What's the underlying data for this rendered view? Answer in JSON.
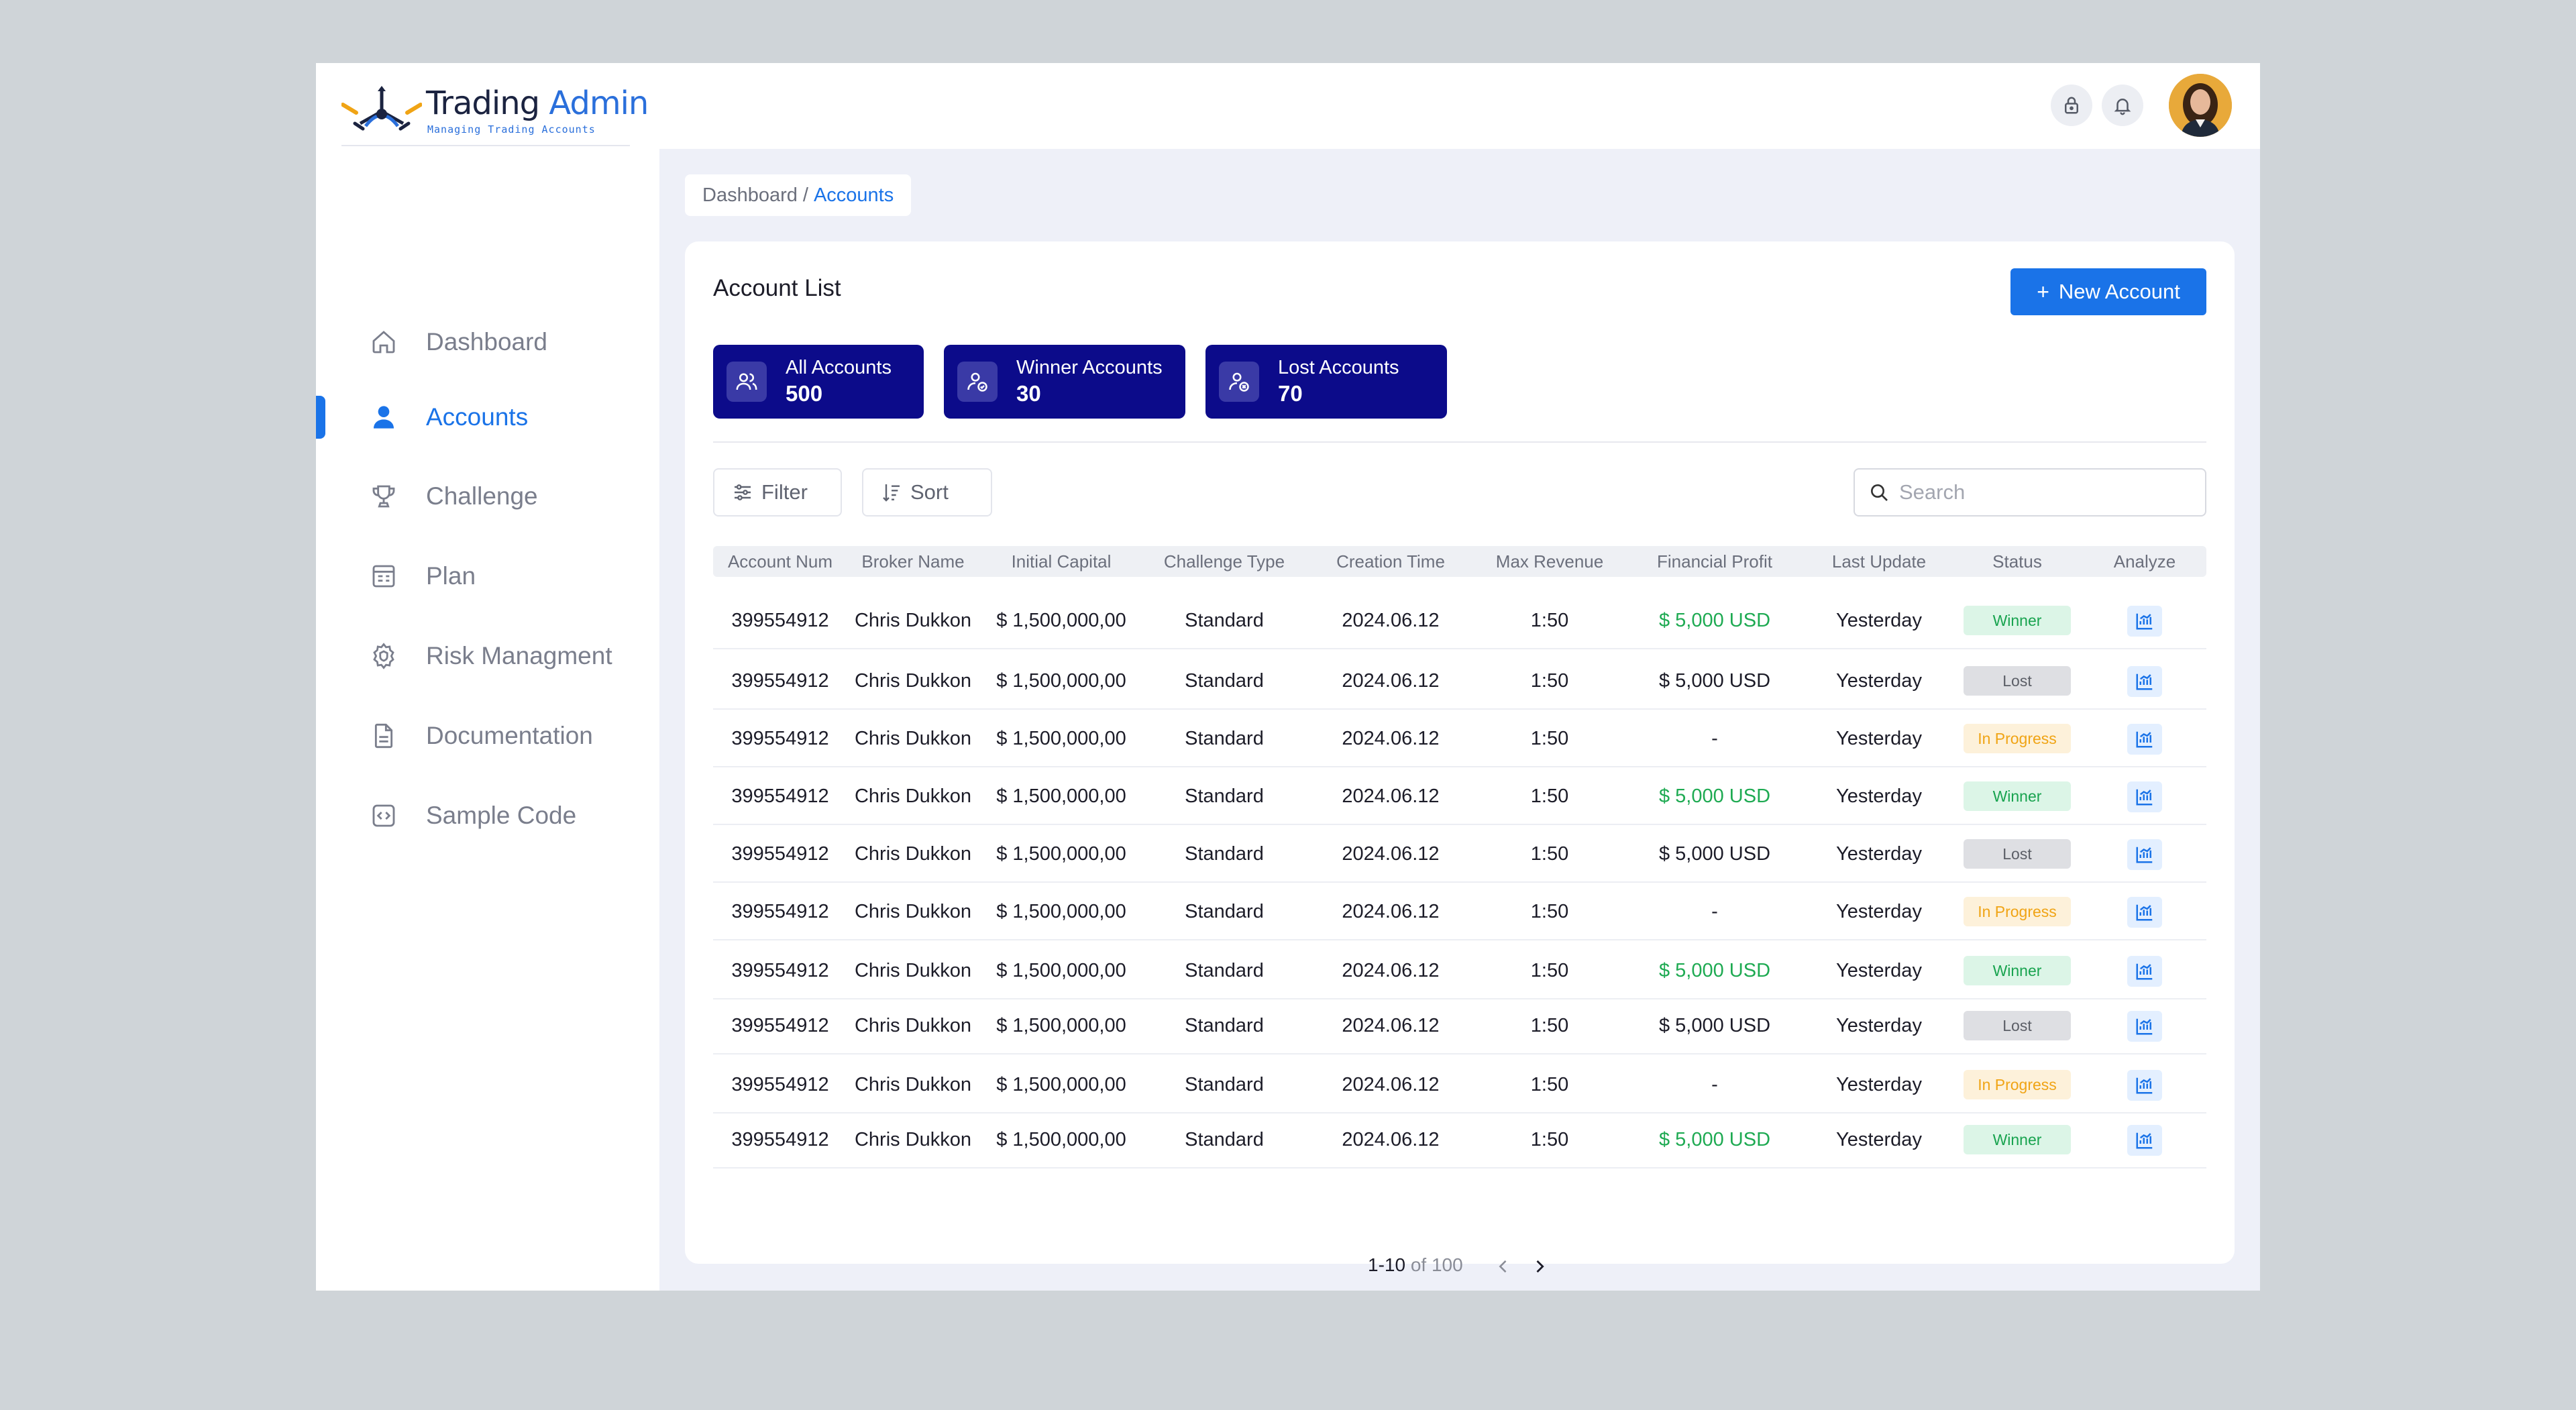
{
  "app": {
    "title_part1": "Trading",
    "title_part2": "Admin",
    "subtitle": "Managing Trading Accounts"
  },
  "sidebar": {
    "items": [
      {
        "label": "Dashboard",
        "icon": "home-icon"
      },
      {
        "label": "Accounts",
        "icon": "user-icon",
        "active": true
      },
      {
        "label": "Challenge",
        "icon": "trophy-icon"
      },
      {
        "label": "Plan",
        "icon": "plan-icon"
      },
      {
        "label": "Risk Managment",
        "icon": "gear-shield-icon"
      },
      {
        "label": "Documentation",
        "icon": "document-icon"
      },
      {
        "label": "Sample Code",
        "icon": "code-icon"
      }
    ]
  },
  "breadcrumb": {
    "root": "Dashboard",
    "separator": "/",
    "current": "Accounts"
  },
  "card": {
    "title": "Account List",
    "new_button": "New Account",
    "new_button_icon": "+"
  },
  "stats": [
    {
      "label": "All Accounts",
      "value": "500"
    },
    {
      "label": "Winner Accounts",
      "value": "30"
    },
    {
      "label": "Lost Accounts",
      "value": "70"
    }
  ],
  "toolbar": {
    "filter": "Filter",
    "sort": "Sort",
    "search_placeholder": "Search"
  },
  "table": {
    "columns": [
      "Account Num",
      "Broker Name",
      "Initial Capital",
      "Challenge Type",
      "Creation Time",
      "Max Revenue",
      "Financial Profit",
      "Last Update",
      "Status",
      "Analyze"
    ],
    "rows": [
      {
        "account": "399554912",
        "broker": "Chris Dukkon",
        "capital": "$ 1,500,000,00",
        "type": "Standard",
        "created": "2024.06.12",
        "max_revenue": "1:50",
        "profit": "$ 5,000 USD",
        "last_update": "Yesterday",
        "status": "Winner"
      },
      {
        "account": "399554912",
        "broker": "Chris Dukkon",
        "capital": "$ 1,500,000,00",
        "type": "Standard",
        "created": "2024.06.12",
        "max_revenue": "1:50",
        "profit": "$ 5,000 USD",
        "last_update": "Yesterday",
        "status": "Lost"
      },
      {
        "account": "399554912",
        "broker": "Chris Dukkon",
        "capital": "$ 1,500,000,00",
        "type": "Standard",
        "created": "2024.06.12",
        "max_revenue": "1:50",
        "profit": "-",
        "last_update": "Yesterday",
        "status": "In Progress"
      },
      {
        "account": "399554912",
        "broker": "Chris Dukkon",
        "capital": "$ 1,500,000,00",
        "type": "Standard",
        "created": "2024.06.12",
        "max_revenue": "1:50",
        "profit": "$ 5,000 USD",
        "last_update": "Yesterday",
        "status": "Winner"
      },
      {
        "account": "399554912",
        "broker": "Chris Dukkon",
        "capital": "$ 1,500,000,00",
        "type": "Standard",
        "created": "2024.06.12",
        "max_revenue": "1:50",
        "profit": "$ 5,000 USD",
        "last_update": "Yesterday",
        "status": "Lost"
      },
      {
        "account": "399554912",
        "broker": "Chris Dukkon",
        "capital": "$ 1,500,000,00",
        "type": "Standard",
        "created": "2024.06.12",
        "max_revenue": "1:50",
        "profit": "-",
        "last_update": "Yesterday",
        "status": "In Progress"
      },
      {
        "account": "399554912",
        "broker": "Chris Dukkon",
        "capital": "$ 1,500,000,00",
        "type": "Standard",
        "created": "2024.06.12",
        "max_revenue": "1:50",
        "profit": "$ 5,000 USD",
        "last_update": "Yesterday",
        "status": "Winner"
      },
      {
        "account": "399554912",
        "broker": "Chris Dukkon",
        "capital": "$ 1,500,000,00",
        "type": "Standard",
        "created": "2024.06.12",
        "max_revenue": "1:50",
        "profit": "$ 5,000 USD",
        "last_update": "Yesterday",
        "status": "Lost"
      },
      {
        "account": "399554912",
        "broker": "Chris Dukkon",
        "capital": "$ 1,500,000,00",
        "type": "Standard",
        "created": "2024.06.12",
        "max_revenue": "1:50",
        "profit": "-",
        "last_update": "Yesterday",
        "status": "In Progress"
      },
      {
        "account": "399554912",
        "broker": "Chris Dukkon",
        "capital": "$ 1,500,000,00",
        "type": "Standard",
        "created": "2024.06.12",
        "max_revenue": "1:50",
        "profit": "$ 5,000 USD",
        "last_update": "Yesterday",
        "status": "Winner"
      }
    ]
  },
  "pagination": {
    "range": "1-10",
    "of_label": "of",
    "total": "100"
  },
  "colors": {
    "accent": "#1a73e8",
    "stat_bg": "#0c0b8a",
    "winner": "#18a34f",
    "lost": "#5b5e66",
    "in_progress": "#f0a415"
  }
}
